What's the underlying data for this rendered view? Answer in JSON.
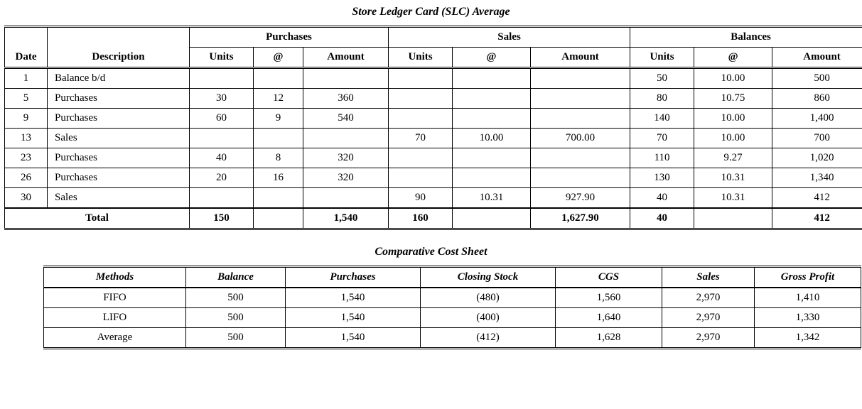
{
  "slc": {
    "title": "Store Ledger Card (SLC) Average",
    "headers": {
      "date": "Date",
      "description": "Description",
      "purchases": "Purchases",
      "sales": "Sales",
      "balances": "Balances",
      "units": "Units",
      "at": "@",
      "amount": "Amount"
    },
    "rows": [
      {
        "date": "1",
        "desc": "Balance b/d",
        "pu": "",
        "pa": "",
        "pm": "",
        "su": "",
        "sa": "",
        "sm": "",
        "bu": "50",
        "ba": "10.00",
        "bm": "500"
      },
      {
        "date": "5",
        "desc": "Purchases",
        "pu": "30",
        "pa": "12",
        "pm": "360",
        "su": "",
        "sa": "",
        "sm": "",
        "bu": "80",
        "ba": "10.75",
        "bm": "860"
      },
      {
        "date": "9",
        "desc": "Purchases",
        "pu": "60",
        "pa": "9",
        "pm": "540",
        "su": "",
        "sa": "",
        "sm": "",
        "bu": "140",
        "ba": "10.00",
        "bm": "1,400"
      },
      {
        "date": "13",
        "desc": "Sales",
        "pu": "",
        "pa": "",
        "pm": "",
        "su": "70",
        "sa": "10.00",
        "sm": "700.00",
        "bu": "70",
        "ba": "10.00",
        "bm": "700"
      },
      {
        "date": "23",
        "desc": "Purchases",
        "pu": "40",
        "pa": "8",
        "pm": "320",
        "su": "",
        "sa": "",
        "sm": "",
        "bu": "110",
        "ba": "9.27",
        "bm": "1,020"
      },
      {
        "date": "26",
        "desc": "Purchases",
        "pu": "20",
        "pa": "16",
        "pm": "320",
        "su": "",
        "sa": "",
        "sm": "",
        "bu": "130",
        "ba": "10.31",
        "bm": "1,340"
      },
      {
        "date": "30",
        "desc": "Sales",
        "pu": "",
        "pa": "",
        "pm": "",
        "su": "90",
        "sa": "10.31",
        "sm": "927.90",
        "bu": "40",
        "ba": "10.31",
        "bm": "412"
      }
    ],
    "total": {
      "label": "Total",
      "pu": "150",
      "pa": "",
      "pm": "1,540",
      "su": "160",
      "sa": "",
      "sm": "1,627.90",
      "bu": "40",
      "ba": "",
      "bm": "412"
    }
  },
  "comp": {
    "title": "Comparative Cost Sheet",
    "headers": {
      "methods": "Methods",
      "balance": "Balance",
      "purchases": "Purchases",
      "closing": "Closing Stock",
      "cgs": "CGS",
      "sales": "Sales",
      "gp": "Gross Profit"
    },
    "rows": [
      {
        "method": "FIFO",
        "balance": "500",
        "purchases": "1,540",
        "closing": "(480)",
        "cgs": "1,560",
        "sales": "2,970",
        "gp": "1,410"
      },
      {
        "method": "LIFO",
        "balance": "500",
        "purchases": "1,540",
        "closing": "(400)",
        "cgs": "1,640",
        "sales": "2,970",
        "gp": "1,330"
      },
      {
        "method": "Average",
        "balance": "500",
        "purchases": "1,540",
        "closing": "(412)",
        "cgs": "1,628",
        "sales": "2,970",
        "gp": "1,342"
      }
    ]
  }
}
